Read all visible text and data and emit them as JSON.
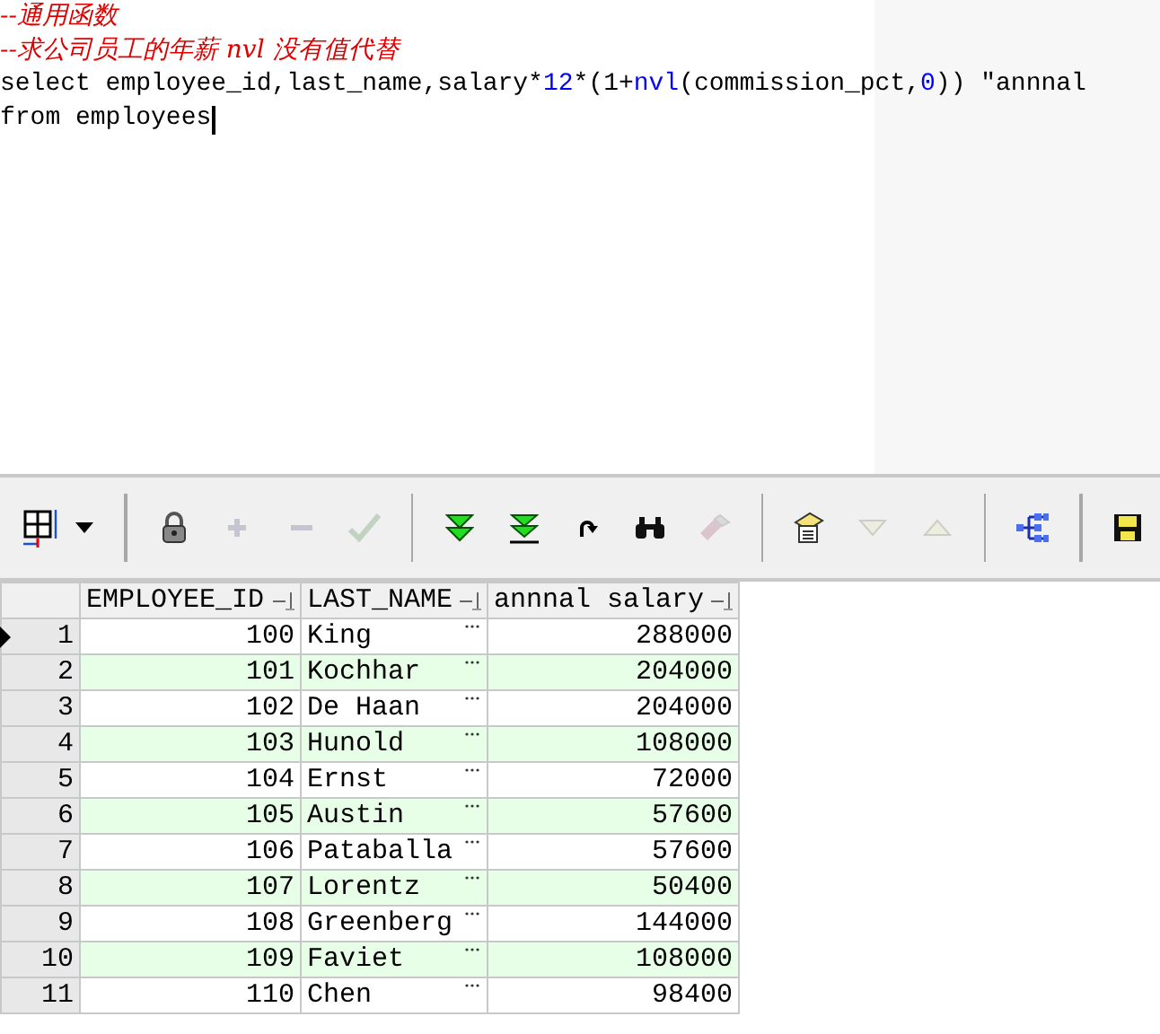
{
  "editor": {
    "lines": [
      [
        {
          "kind": "comment",
          "text": "--通用函数"
        }
      ],
      [
        {
          "kind": "comment",
          "text": "--求公司员工的年薪 nvl 没有值代替"
        }
      ],
      [
        {
          "kind": "plain",
          "text": "select employee_id,last_name,salary*"
        },
        {
          "kind": "number",
          "text": "12"
        },
        {
          "kind": "plain",
          "text": "*(1+"
        },
        {
          "kind": "function",
          "text": "nvl"
        },
        {
          "kind": "plain",
          "text": "(commission_pct,"
        },
        {
          "kind": "number",
          "text": "0"
        },
        {
          "kind": "plain",
          "text": ")) \"annnal"
        }
      ],
      [
        {
          "kind": "plain",
          "text": "from employees"
        }
      ]
    ]
  },
  "toolbar": [
    [
      {
        "disabled": false
      },
      {
        "disabled": false
      }
    ],
    [
      {
        "disabled": false
      },
      {
        "disabled": true
      },
      {
        "disabled": true
      },
      {
        "disabled": true
      }
    ],
    [
      {
        "disabled": false
      },
      {
        "disabled": false
      },
      {
        "disabled": false
      },
      {
        "disabled": false
      },
      {
        "disabled": true
      }
    ],
    [
      {
        "disabled": false
      },
      {
        "disabled": true
      },
      {
        "disabled": true
      }
    ],
    [
      {
        "disabled": false
      }
    ],
    [
      {
        "disabled": false
      }
    ]
  ],
  "grid": {
    "columns": [
      "EMPLOYEE_ID",
      "LAST_NAME",
      "annnal salary"
    ],
    "rows": [
      {
        "num": "1",
        "selected": true,
        "cells": [
          "100",
          "King",
          "288000"
        ]
      },
      {
        "num": "2",
        "selected": false,
        "cells": [
          "101",
          "Kochhar",
          "204000"
        ]
      },
      {
        "num": "3",
        "selected": false,
        "cells": [
          "102",
          "De Haan",
          "204000"
        ]
      },
      {
        "num": "4",
        "selected": false,
        "cells": [
          "103",
          "Hunold",
          "108000"
        ]
      },
      {
        "num": "5",
        "selected": false,
        "cells": [
          "104",
          "Ernst",
          "72000"
        ]
      },
      {
        "num": "6",
        "selected": false,
        "cells": [
          "105",
          "Austin",
          "57600"
        ]
      },
      {
        "num": "7",
        "selected": false,
        "cells": [
          "106",
          "Pataballa",
          "57600"
        ]
      },
      {
        "num": "8",
        "selected": false,
        "cells": [
          "107",
          "Lorentz",
          "50400"
        ]
      },
      {
        "num": "9",
        "selected": false,
        "cells": [
          "108",
          "Greenberg",
          "144000"
        ]
      },
      {
        "num": "10",
        "selected": false,
        "cells": [
          "109",
          "Faviet",
          "108000"
        ]
      },
      {
        "num": "11",
        "selected": false,
        "cells": [
          "110",
          "Chen",
          "98400"
        ]
      }
    ]
  }
}
